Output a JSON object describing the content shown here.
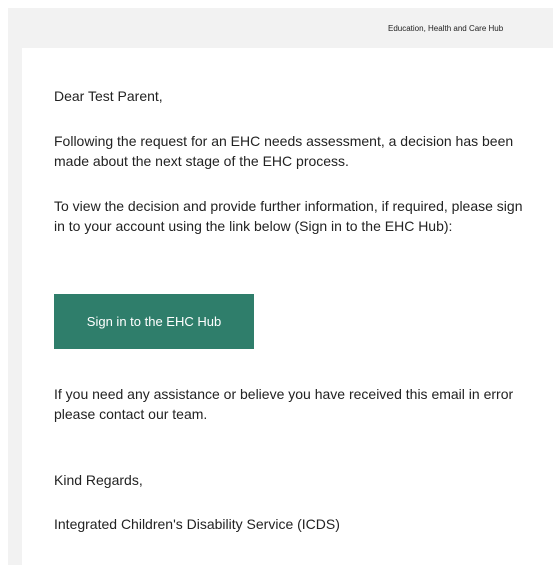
{
  "header": {
    "title": "Education, Health and Care Hub"
  },
  "email": {
    "greeting": "Dear Test Parent,",
    "paragraph_1": "Following the request for an EHC needs assessment, a decision has been made about the next stage of the EHC process.",
    "paragraph_2": "To view the decision and provide further information, if required, please sign in to your account using the link below (Sign in to the EHC Hub):",
    "cta_label": "Sign in to the EHC Hub",
    "paragraph_3": "If you need any assistance or believe you have received this email in error please contact our team.",
    "sign_off": "Kind Regards,",
    "signature": "Integrated Children's Disability Service (ICDS)"
  },
  "colors": {
    "button_background": "#2f7e6b",
    "button_text": "#ffffff",
    "outer_background": "#f2f2f2",
    "card_background": "#ffffff",
    "body_text": "#222222"
  }
}
